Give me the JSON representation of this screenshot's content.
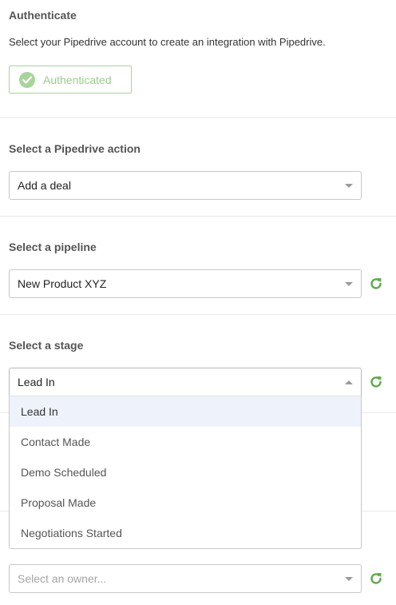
{
  "authenticate": {
    "heading": "Authenticate",
    "description": "Select your Pipedrive account to create an integration with Pipedrive.",
    "button_label": "Authenticated"
  },
  "action": {
    "heading": "Select a Pipedrive action",
    "value": "Add a deal"
  },
  "pipeline": {
    "heading": "Select a pipeline",
    "value": "New Product XYZ"
  },
  "stage": {
    "heading": "Select a stage",
    "value": "Lead In",
    "options": [
      "Lead In",
      "Contact Made",
      "Demo Scheduled",
      "Proposal Made",
      "Negotiations Started"
    ],
    "selected_index": 0
  },
  "owner": {
    "placeholder": "Select an owner..."
  },
  "colors": {
    "accent_green": "#5fa84e",
    "auth_green": "#a8d49c",
    "selected_bg": "#eef3fb"
  }
}
